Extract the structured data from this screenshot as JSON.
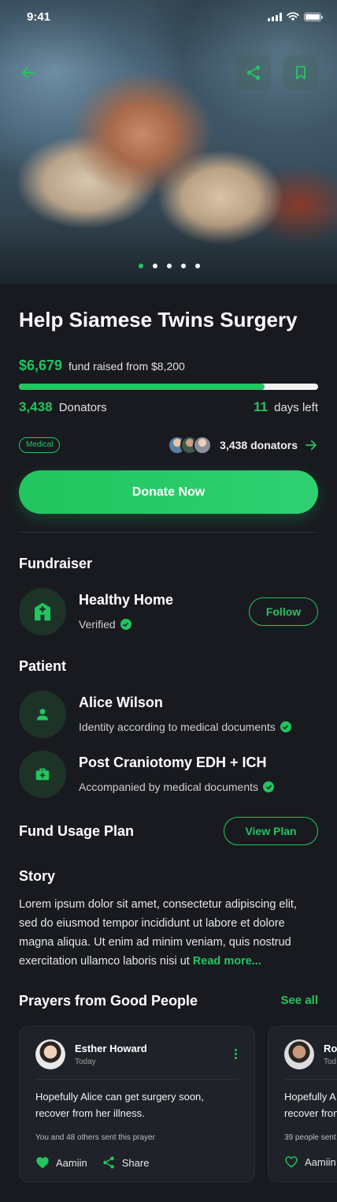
{
  "status_bar": {
    "time": "9:41"
  },
  "hero": {
    "slides": 5,
    "active_slide": 0
  },
  "campaign": {
    "title": "Help Siamese Twins Surgery",
    "raised_amount": "$6,679",
    "raised_text": "fund raised from $8,200",
    "progress_fraction": 0.82,
    "donators_count": "3,438",
    "donators_label": "Donators",
    "days_left_count": "11",
    "days_left_label": "days left",
    "category": "Medical",
    "donors_link": "3,438 donators",
    "donate_label": "Donate Now"
  },
  "fundraiser": {
    "heading": "Fundraiser",
    "name": "Healthy Home",
    "status": "Verified",
    "follow_label": "Follow"
  },
  "patient": {
    "heading": "Patient",
    "name": "Alice Wilson",
    "name_note": "Identity according to medical documents",
    "condition": "Post Craniotomy EDH + ICH",
    "condition_note": "Accompanied by medical documents"
  },
  "fund_plan": {
    "heading": "Fund Usage Plan",
    "button_label": "View Plan"
  },
  "story": {
    "heading": "Story",
    "text": "Lorem ipsum dolor sit amet, consectetur adipiscing elit, sed do eiusmod tempor incididunt ut labore et dolore magna aliqua. Ut enim ad minim veniam, quis nostrud exercitation ullamco laboris nisi ut ",
    "read_more": "Read more..."
  },
  "prayers": {
    "heading": "Prayers from Good People",
    "see_all": "See all",
    "items": [
      {
        "name": "Esther Howard",
        "date": "Today",
        "message": "Hopefully Alice can get surgery soon, recover from her illness.",
        "count_text": "You and 48 others sent this prayer",
        "like_label": "Aamiin",
        "share_label": "Share"
      },
      {
        "name": "Ro",
        "date": "Tod",
        "message": "Hopefully A recover fron",
        "count_text": "39 people sent",
        "like_label": "Aamiin",
        "share_label": ""
      }
    ]
  },
  "colors": {
    "accent": "#22c55e",
    "background": "#181a20",
    "card": "#1f2229"
  }
}
